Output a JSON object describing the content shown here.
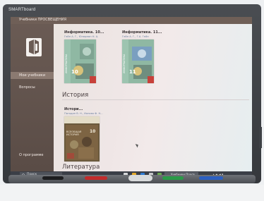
{
  "board": {
    "brand": "SMARTboard"
  },
  "window": {
    "title": "Учебники ПРОСВЕЩЕНИЯ"
  },
  "sidebar": {
    "items": [
      {
        "label": "Мои учебники"
      },
      {
        "label": "Вопросы"
      }
    ],
    "footer_label": "О программе"
  },
  "books_top": [
    {
      "title": "Информатика. 10...",
      "authors": "Гейн А. Г., Юнерман Н. А.",
      "cover_label": "ИНФОРМАТИКА",
      "grade": "10"
    },
    {
      "title": "Информатика. 11...",
      "authors": "Гейн А. Г., Г.А. Гейн",
      "cover_label": "ИНФОРМАТИКА",
      "grade": "11"
    }
  ],
  "sections": [
    {
      "heading": "История",
      "books": [
        {
          "title": "Истори...",
          "authors": "Погодин В. Н., Ионова Ф. Н...",
          "cover_label": "ВСЕОБЩАЯ ИСТОРИЯ",
          "grade": "10"
        }
      ]
    },
    {
      "heading": "Литература",
      "books": []
    }
  ],
  "taskbar": {
    "search_placeholder": "Поиск",
    "app_label": "Учебники Просв..."
  },
  "colors": {
    "sidebar": "#6a5b54",
    "accent_active": "#8b7a71",
    "cover_green": "#8fb8a3",
    "cover_red": "#c7413a"
  }
}
